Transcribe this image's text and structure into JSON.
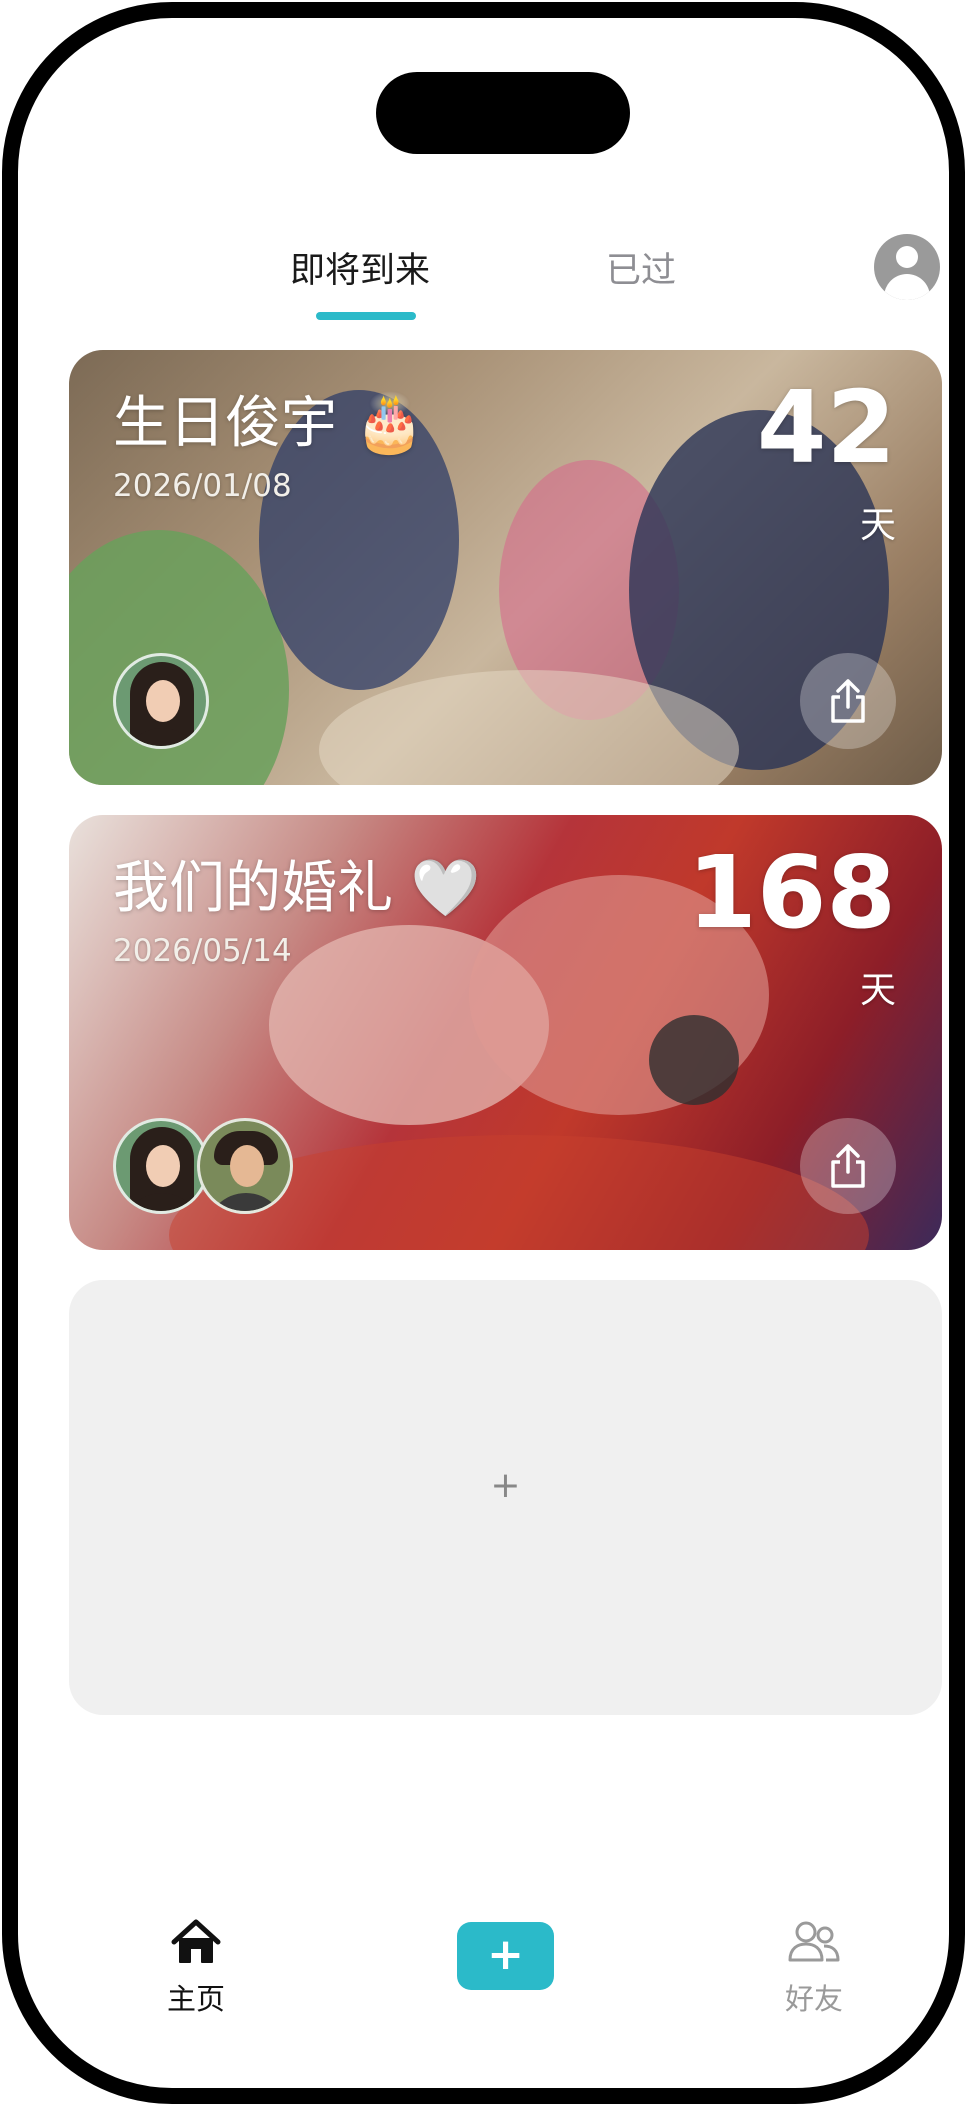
{
  "header": {
    "tabs": [
      {
        "label": "即将到来",
        "active": true
      },
      {
        "label": "已过",
        "active": false
      }
    ],
    "profile_icon": "person-icon"
  },
  "events": [
    {
      "title": "生日俊宇 🎂",
      "date": "2026/01/08",
      "days": "42",
      "days_unit": "天",
      "share_icon": "share-icon",
      "participants": 1
    },
    {
      "title": "我们的婚礼 🤍",
      "date": "2026/05/14",
      "days": "168",
      "days_unit": "天",
      "share_icon": "share-icon",
      "participants": 2
    }
  ],
  "add_card": {
    "label": "+"
  },
  "bottom_nav": {
    "home_label": "主页",
    "add_label": "+",
    "friends_label": "好友"
  },
  "colors": {
    "accent": "#2bbac9",
    "inactive": "#9a9a9a"
  }
}
